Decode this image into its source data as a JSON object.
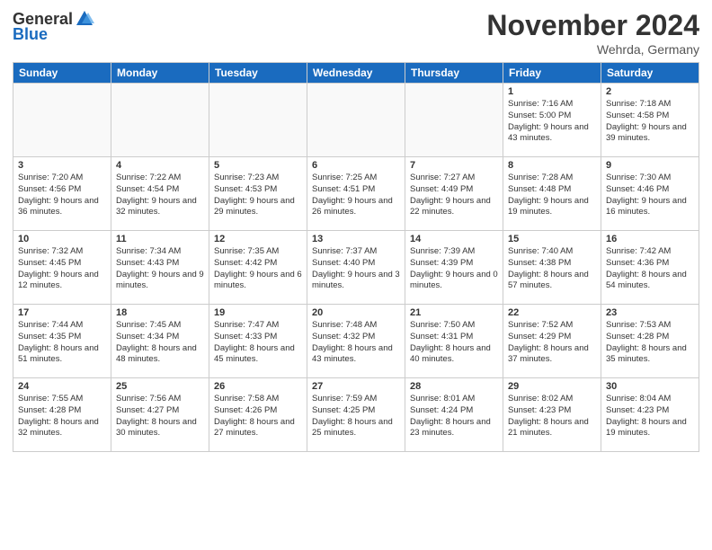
{
  "header": {
    "logo_general": "General",
    "logo_blue": "Blue",
    "month_title": "November 2024",
    "location": "Wehrda, Germany"
  },
  "days_of_week": [
    "Sunday",
    "Monday",
    "Tuesday",
    "Wednesday",
    "Thursday",
    "Friday",
    "Saturday"
  ],
  "weeks": [
    [
      {
        "day": "",
        "info": ""
      },
      {
        "day": "",
        "info": ""
      },
      {
        "day": "",
        "info": ""
      },
      {
        "day": "",
        "info": ""
      },
      {
        "day": "",
        "info": ""
      },
      {
        "day": "1",
        "info": "Sunrise: 7:16 AM\nSunset: 5:00 PM\nDaylight: 9 hours\nand 43 minutes."
      },
      {
        "day": "2",
        "info": "Sunrise: 7:18 AM\nSunset: 4:58 PM\nDaylight: 9 hours\nand 39 minutes."
      }
    ],
    [
      {
        "day": "3",
        "info": "Sunrise: 7:20 AM\nSunset: 4:56 PM\nDaylight: 9 hours\nand 36 minutes."
      },
      {
        "day": "4",
        "info": "Sunrise: 7:22 AM\nSunset: 4:54 PM\nDaylight: 9 hours\nand 32 minutes."
      },
      {
        "day": "5",
        "info": "Sunrise: 7:23 AM\nSunset: 4:53 PM\nDaylight: 9 hours\nand 29 minutes."
      },
      {
        "day": "6",
        "info": "Sunrise: 7:25 AM\nSunset: 4:51 PM\nDaylight: 9 hours\nand 26 minutes."
      },
      {
        "day": "7",
        "info": "Sunrise: 7:27 AM\nSunset: 4:49 PM\nDaylight: 9 hours\nand 22 minutes."
      },
      {
        "day": "8",
        "info": "Sunrise: 7:28 AM\nSunset: 4:48 PM\nDaylight: 9 hours\nand 19 minutes."
      },
      {
        "day": "9",
        "info": "Sunrise: 7:30 AM\nSunset: 4:46 PM\nDaylight: 9 hours\nand 16 minutes."
      }
    ],
    [
      {
        "day": "10",
        "info": "Sunrise: 7:32 AM\nSunset: 4:45 PM\nDaylight: 9 hours\nand 12 minutes."
      },
      {
        "day": "11",
        "info": "Sunrise: 7:34 AM\nSunset: 4:43 PM\nDaylight: 9 hours\nand 9 minutes."
      },
      {
        "day": "12",
        "info": "Sunrise: 7:35 AM\nSunset: 4:42 PM\nDaylight: 9 hours\nand 6 minutes."
      },
      {
        "day": "13",
        "info": "Sunrise: 7:37 AM\nSunset: 4:40 PM\nDaylight: 9 hours\nand 3 minutes."
      },
      {
        "day": "14",
        "info": "Sunrise: 7:39 AM\nSunset: 4:39 PM\nDaylight: 9 hours\nand 0 minutes."
      },
      {
        "day": "15",
        "info": "Sunrise: 7:40 AM\nSunset: 4:38 PM\nDaylight: 8 hours\nand 57 minutes."
      },
      {
        "day": "16",
        "info": "Sunrise: 7:42 AM\nSunset: 4:36 PM\nDaylight: 8 hours\nand 54 minutes."
      }
    ],
    [
      {
        "day": "17",
        "info": "Sunrise: 7:44 AM\nSunset: 4:35 PM\nDaylight: 8 hours\nand 51 minutes."
      },
      {
        "day": "18",
        "info": "Sunrise: 7:45 AM\nSunset: 4:34 PM\nDaylight: 8 hours\nand 48 minutes."
      },
      {
        "day": "19",
        "info": "Sunrise: 7:47 AM\nSunset: 4:33 PM\nDaylight: 8 hours\nand 45 minutes."
      },
      {
        "day": "20",
        "info": "Sunrise: 7:48 AM\nSunset: 4:32 PM\nDaylight: 8 hours\nand 43 minutes."
      },
      {
        "day": "21",
        "info": "Sunrise: 7:50 AM\nSunset: 4:31 PM\nDaylight: 8 hours\nand 40 minutes."
      },
      {
        "day": "22",
        "info": "Sunrise: 7:52 AM\nSunset: 4:29 PM\nDaylight: 8 hours\nand 37 minutes."
      },
      {
        "day": "23",
        "info": "Sunrise: 7:53 AM\nSunset: 4:28 PM\nDaylight: 8 hours\nand 35 minutes."
      }
    ],
    [
      {
        "day": "24",
        "info": "Sunrise: 7:55 AM\nSunset: 4:28 PM\nDaylight: 8 hours\nand 32 minutes."
      },
      {
        "day": "25",
        "info": "Sunrise: 7:56 AM\nSunset: 4:27 PM\nDaylight: 8 hours\nand 30 minutes."
      },
      {
        "day": "26",
        "info": "Sunrise: 7:58 AM\nSunset: 4:26 PM\nDaylight: 8 hours\nand 27 minutes."
      },
      {
        "day": "27",
        "info": "Sunrise: 7:59 AM\nSunset: 4:25 PM\nDaylight: 8 hours\nand 25 minutes."
      },
      {
        "day": "28",
        "info": "Sunrise: 8:01 AM\nSunset: 4:24 PM\nDaylight: 8 hours\nand 23 minutes."
      },
      {
        "day": "29",
        "info": "Sunrise: 8:02 AM\nSunset: 4:23 PM\nDaylight: 8 hours\nand 21 minutes."
      },
      {
        "day": "30",
        "info": "Sunrise: 8:04 AM\nSunset: 4:23 PM\nDaylight: 8 hours\nand 19 minutes."
      }
    ]
  ]
}
